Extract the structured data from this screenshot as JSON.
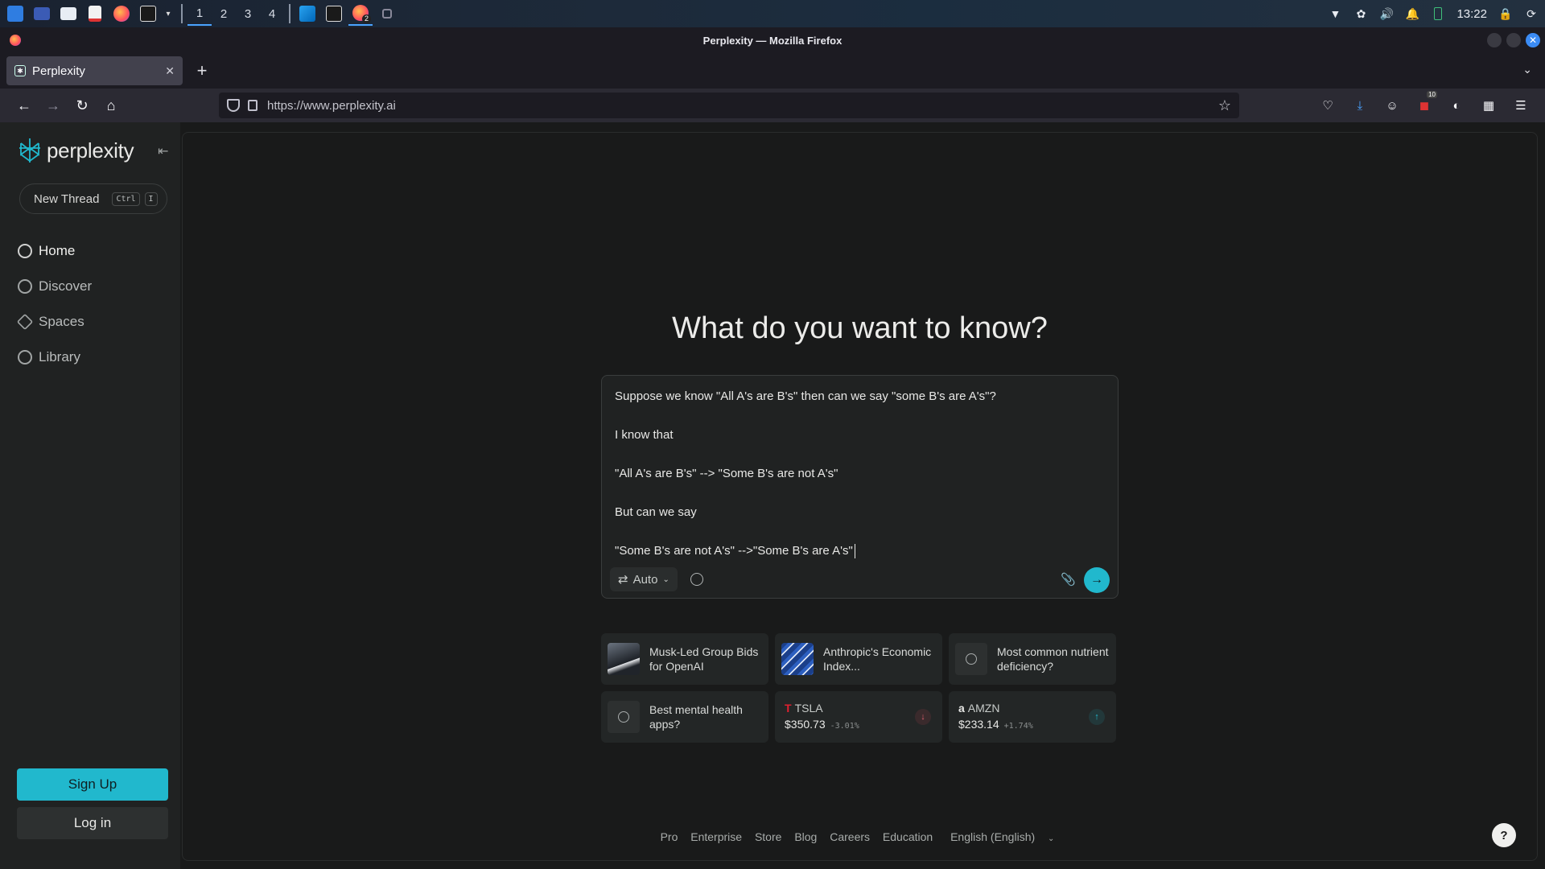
{
  "os_taskbar": {
    "workspaces": [
      "1",
      "2",
      "3",
      "4"
    ],
    "active_workspace": "1",
    "clock": "13:22",
    "app_icons": [
      "kde-menu-icon",
      "desktop-icon",
      "file-manager-icon",
      "pdf-icon",
      "firefox-icon",
      "terminal-icon",
      "vscode-icon",
      "terminal-icon",
      "firefox-icon"
    ],
    "firefox_badge": "2"
  },
  "browser": {
    "window_title": "Perplexity — Mozilla Firefox",
    "tab_title": "Perplexity",
    "url": "https://www.perplexity.ai",
    "addon_badge": "10"
  },
  "sidebar": {
    "logo_text": "perplexity",
    "new_thread_label": "New Thread",
    "new_thread_kbd": [
      "Ctrl",
      "I"
    ],
    "nav": [
      {
        "label": "Home",
        "icon": "search-icon"
      },
      {
        "label": "Discover",
        "icon": "globe-icon"
      },
      {
        "label": "Spaces",
        "icon": "spaces-icon"
      },
      {
        "label": "Library",
        "icon": "library-icon"
      }
    ],
    "signup_label": "Sign Up",
    "login_label": "Log in",
    "accent_color": "#21b8cd"
  },
  "main": {
    "title": "What do you want to know?",
    "query_lines": [
      "Suppose we know \"All A's are B's\" then can we say \"some B's are A's\"?",
      "I know that",
      "\"All A's are B's\" --> \"Some B's are not A's\"",
      "But can we say",
      "\"Some B's are not A's\" -->\"Some B's are A's\""
    ],
    "mode_label": "Auto"
  },
  "cards": [
    {
      "type": "news",
      "label": "Musk-Led Group Bids for OpenAI",
      "thumb": "musk-thumbnail"
    },
    {
      "type": "news",
      "label": "Anthropic's Economic Index...",
      "thumb": "anthropic-thumbnail"
    },
    {
      "type": "search",
      "label": "Most common nutrient deficiency?"
    },
    {
      "type": "search",
      "label": "Best mental health apps?"
    },
    {
      "type": "stock",
      "ticker": "TSLA",
      "price": "$350.73",
      "change": "-3.01%",
      "direction": "down"
    },
    {
      "type": "stock",
      "ticker": "AMZN",
      "price": "$233.14",
      "change": "+1.74%",
      "direction": "up"
    }
  ],
  "footer": {
    "links": [
      "Pro",
      "Enterprise",
      "Store",
      "Blog",
      "Careers",
      "Education"
    ],
    "language": "English (English)"
  },
  "help_label": "?"
}
